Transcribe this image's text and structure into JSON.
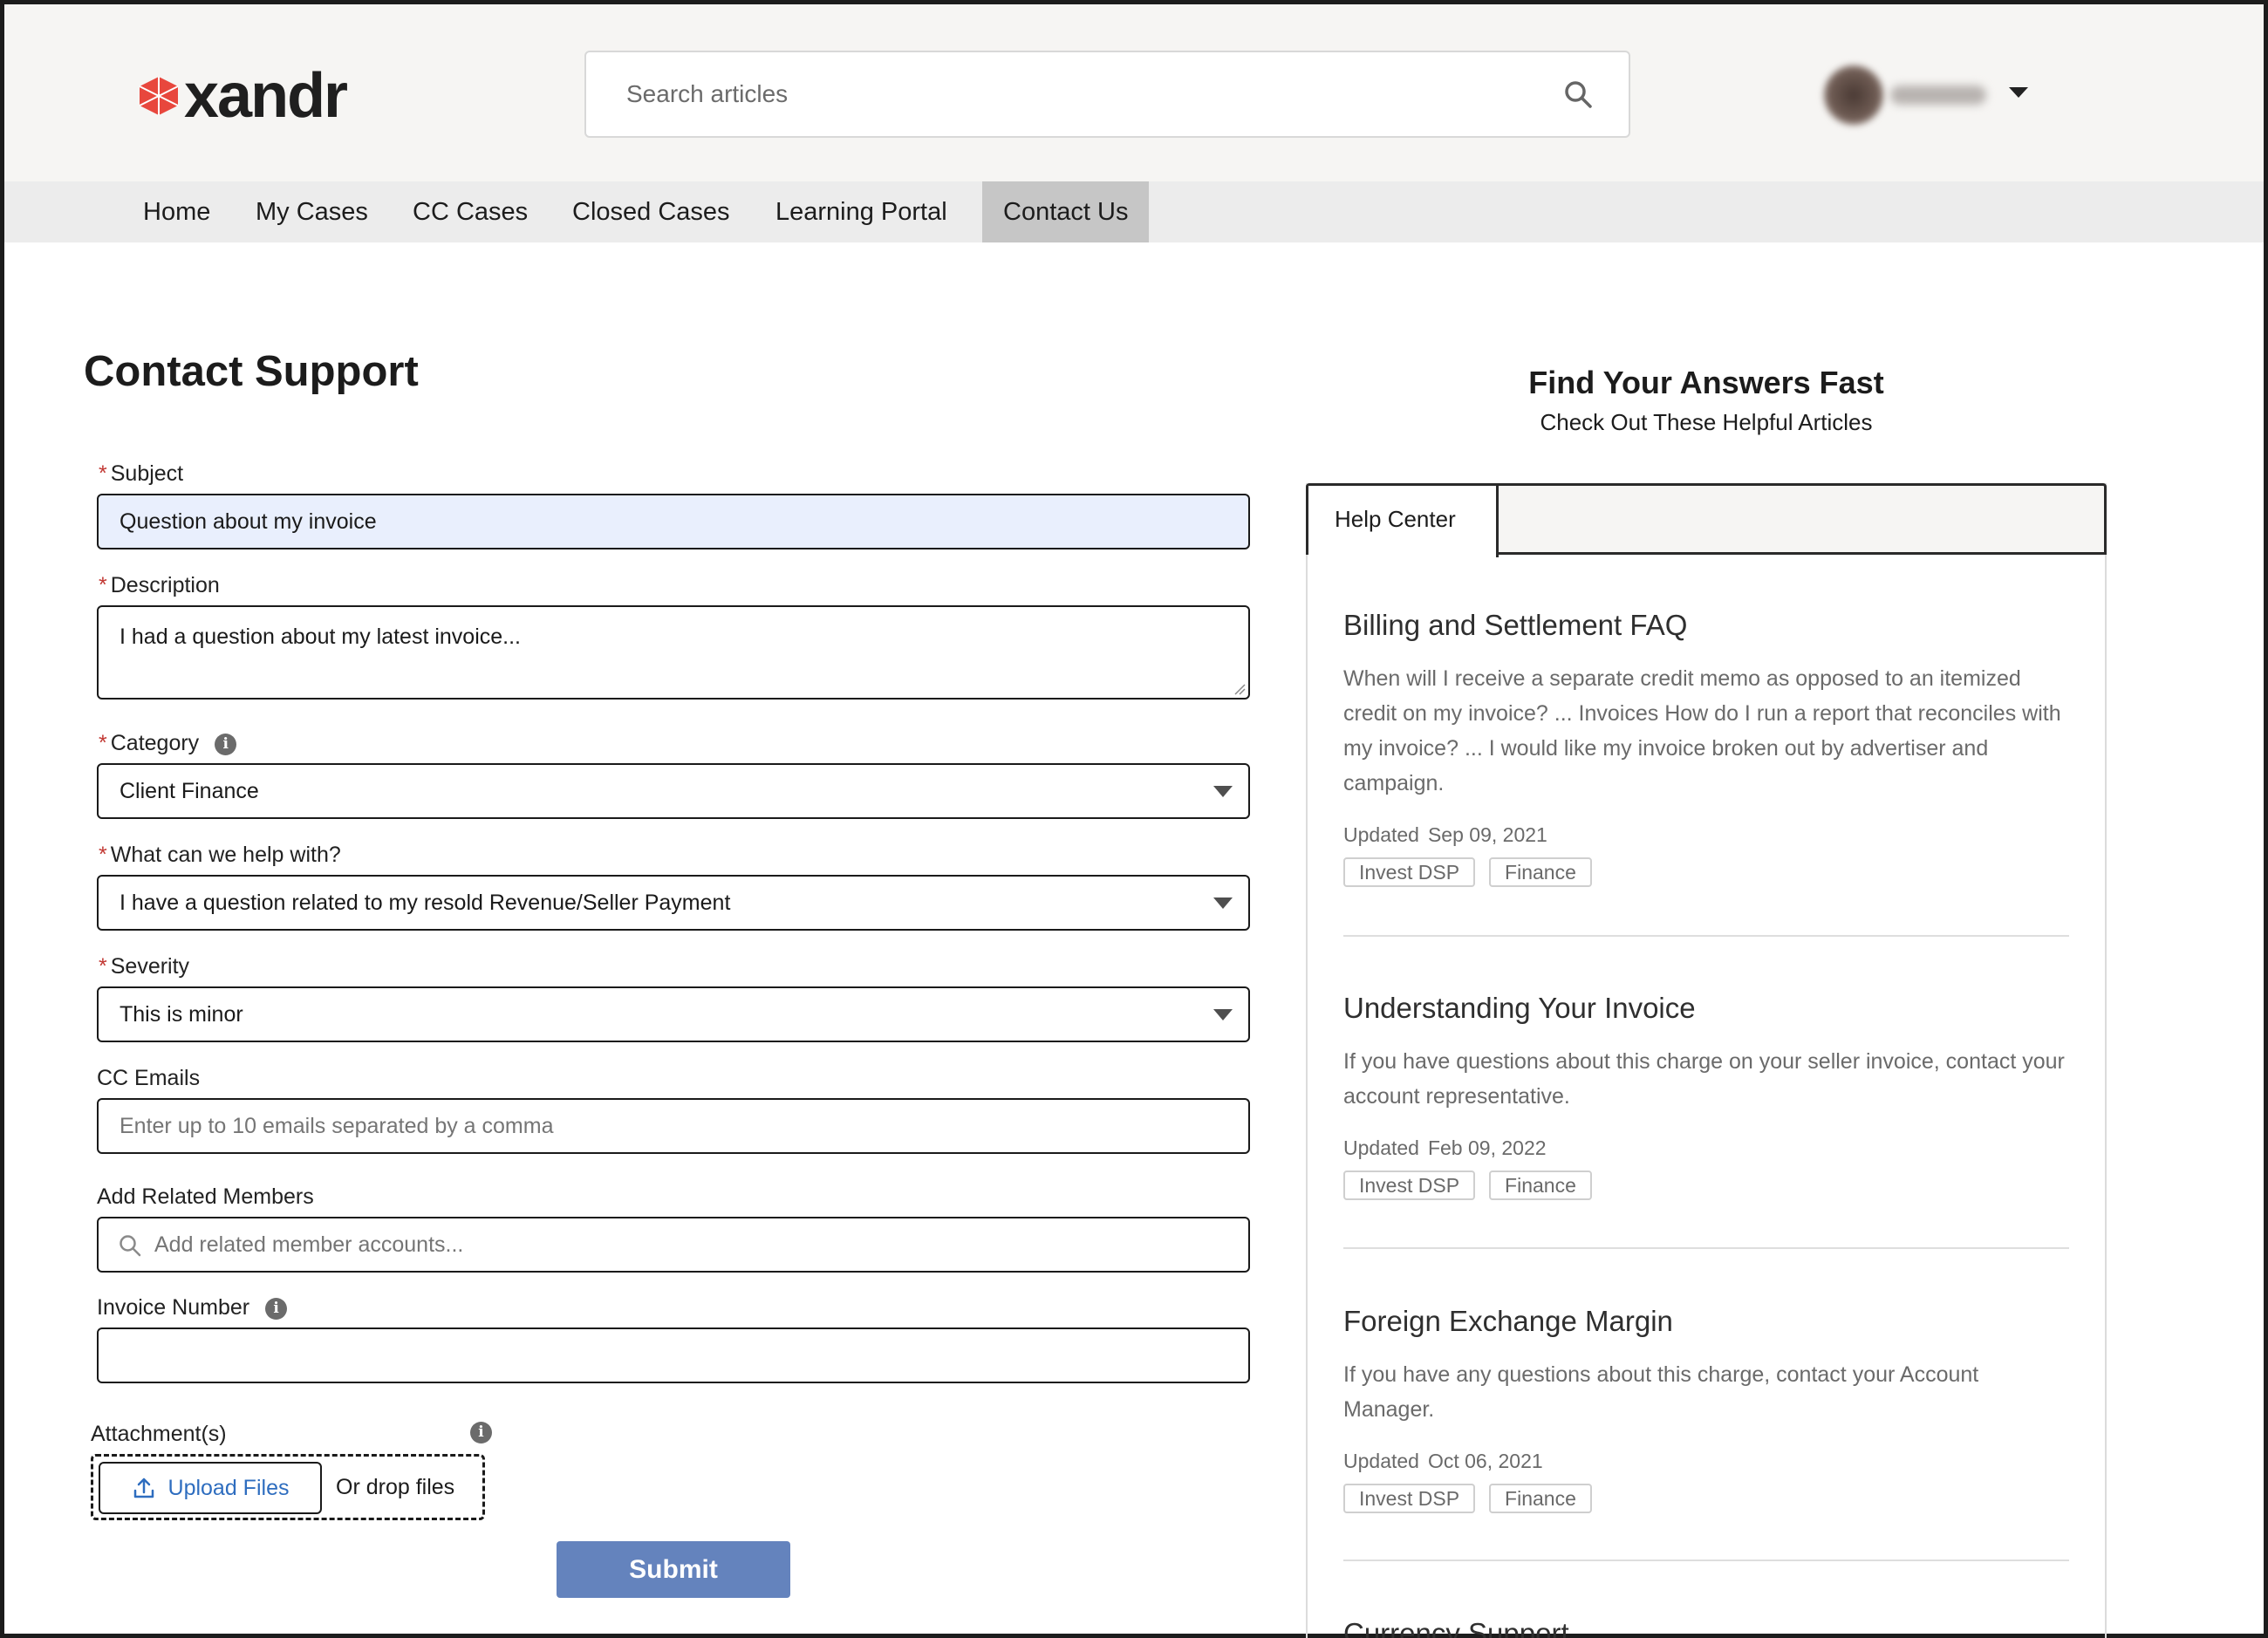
{
  "brand": {
    "logo_text": "xandr",
    "logo_color": "#e8473d"
  },
  "search": {
    "placeholder": "Search articles",
    "icon": "search-icon"
  },
  "user_menu": {
    "icon": "chevron-down-icon"
  },
  "nav": {
    "tabs": [
      {
        "label": "Home"
      },
      {
        "label": "My Cases"
      },
      {
        "label": "CC Cases"
      },
      {
        "label": "Closed Cases"
      },
      {
        "label": "Learning Portal"
      },
      {
        "label": "Contact Us",
        "active": true
      }
    ]
  },
  "form": {
    "title": "Contact Support",
    "subject": {
      "label": "Subject",
      "value": "Question about my invoice",
      "required": true
    },
    "description": {
      "label": "Description",
      "value": "I had a question about my latest invoice...",
      "required": true
    },
    "category": {
      "label": "Category",
      "value": "Client Finance",
      "required": true
    },
    "help_with": {
      "label": "What can we help with?",
      "value": "I have a question related to my resold Revenue/Seller Payment",
      "required": true
    },
    "severity": {
      "label": "Severity",
      "value": "This is minor",
      "required": true
    },
    "cc_emails": {
      "label": "CC Emails",
      "placeholder": "Enter up to 10 emails separated by a comma"
    },
    "related_members": {
      "label": "Add Related Members",
      "placeholder": "Add related member accounts..."
    },
    "invoice_number": {
      "label": "Invoice Number",
      "value": ""
    },
    "attachments": {
      "label": "Attachment(s)",
      "upload_label": "Upload Files",
      "drop_label": "Or drop files"
    },
    "submit_label": "Submit",
    "required_marker": "*",
    "info_glyph": "i"
  },
  "help": {
    "title": "Find Your Answers Fast",
    "subtitle": "Check Out These Helpful Articles",
    "tab_label": "Help Center",
    "updated_label": "Updated",
    "articles": [
      {
        "title": "Billing and Settlement FAQ",
        "body": "When will I receive a separate credit memo as opposed to an itemized credit on my invoice? ... Invoices How do I run a report that reconciles with my invoice? ... I would like my invoice broken out by advertiser and campaign.",
        "updated": "Sep 09, 2021",
        "tags": [
          "Invest DSP",
          "Finance"
        ]
      },
      {
        "title": "Understanding Your Invoice",
        "body": "If you have questions about this charge on your seller invoice, contact your account representative.",
        "updated": "Feb 09, 2022",
        "tags": [
          "Invest DSP",
          "Finance"
        ]
      },
      {
        "title": "Foreign Exchange Margin",
        "body": "If you have any questions about this charge, contact your Account Manager.",
        "updated": "Oct 06, 2021",
        "tags": [
          "Invest DSP",
          "Finance"
        ]
      },
      {
        "title": "Currency Support"
      }
    ]
  },
  "colors": {
    "submit_bg": "#6483bd",
    "link_blue": "#2e6dbf",
    "required_red": "#c23934",
    "filled_field_bg": "#e9effd"
  }
}
